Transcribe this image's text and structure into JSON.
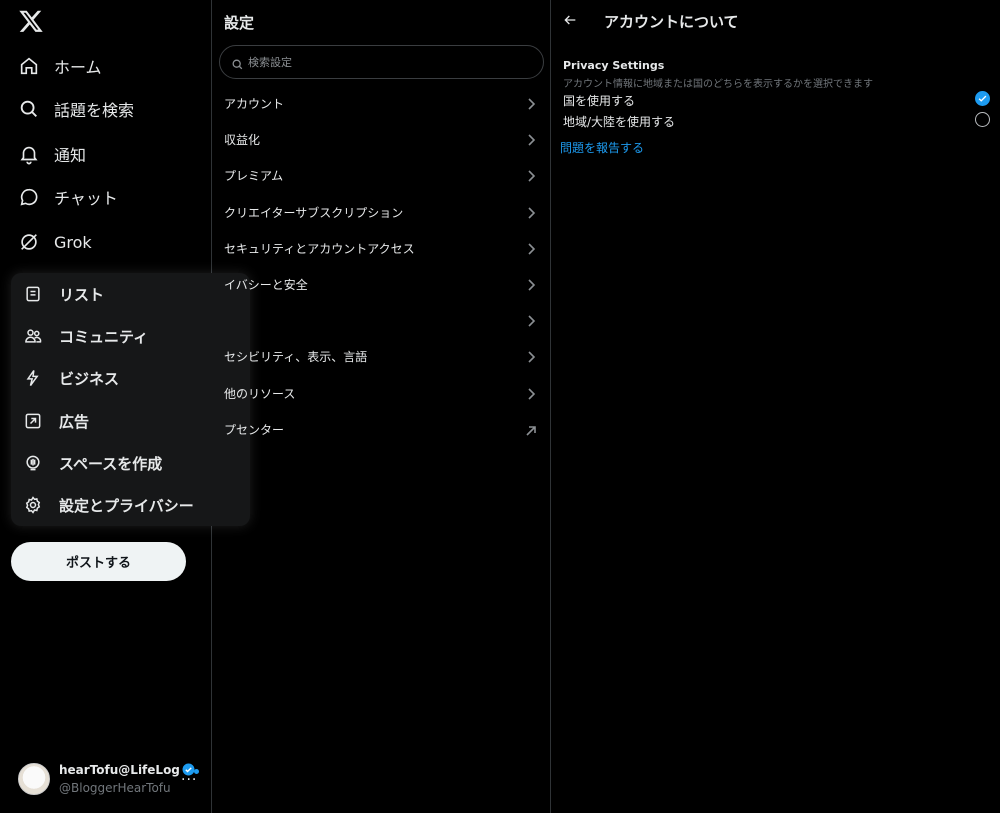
{
  "nav": {
    "items": [
      {
        "label": "ホーム",
        "icon": "home-icon"
      },
      {
        "label": "話題を検索",
        "icon": "search-icon"
      },
      {
        "label": "通知",
        "icon": "bell-icon"
      },
      {
        "label": "チャット",
        "icon": "chat-bubble-icon"
      },
      {
        "label": "Grok",
        "icon": "grok-icon"
      }
    ]
  },
  "more_menu": {
    "items": [
      {
        "label": "リスト",
        "icon": "list-icon"
      },
      {
        "label": "コミュニティ",
        "icon": "community-icon"
      },
      {
        "label": "ビジネス",
        "icon": "lightning-icon"
      },
      {
        "label": "広告",
        "icon": "external-arrow-icon"
      },
      {
        "label": "スペースを作成",
        "icon": "microphone-icon"
      },
      {
        "label": "設定とプライバシー",
        "icon": "gear-icon"
      }
    ]
  },
  "post_button": "ポストする",
  "account": {
    "name": "hearTofu@LifeLog",
    "handle": "@BloggerHearTofu",
    "more": "···"
  },
  "settings": {
    "title": "設定",
    "search_placeholder": "検索設定",
    "items": [
      {
        "label": "アカウント",
        "icon": "chevron-right-icon"
      },
      {
        "label": "収益化",
        "icon": "chevron-right-icon"
      },
      {
        "label": "プレミアム",
        "icon": "chevron-right-icon"
      },
      {
        "label": "クリエイターサブスクリプション",
        "icon": "chevron-right-icon"
      },
      {
        "label": "セキュリティとアカウントアクセス",
        "icon": "chevron-right-icon"
      },
      {
        "label": "イバシーと安全",
        "icon": "chevron-right-icon"
      },
      {
        "label": "",
        "icon": "chevron-right-icon"
      },
      {
        "label": "セシビリティ、表示、言語",
        "icon": "chevron-right-icon"
      },
      {
        "label": "他のリソース",
        "icon": "chevron-right-icon"
      },
      {
        "label": "プセンター",
        "icon": "external-link-icon"
      }
    ]
  },
  "detail": {
    "title": "アカウントについて",
    "section_title": "Privacy Settings",
    "section_desc": "アカウント情報に地域または国のどちらを表示するかを選択できます",
    "options": [
      {
        "label": "国を使用する",
        "selected": true
      },
      {
        "label": "地域/大陸を使用する",
        "selected": false
      }
    ],
    "report_link": "問題を報告する"
  },
  "colors": {
    "background": "#000000",
    "text": "#e7e9ea",
    "muted": "#71767b",
    "accent": "#1d9bf0",
    "border": "#2f3336",
    "menu_bg": "#161718"
  }
}
